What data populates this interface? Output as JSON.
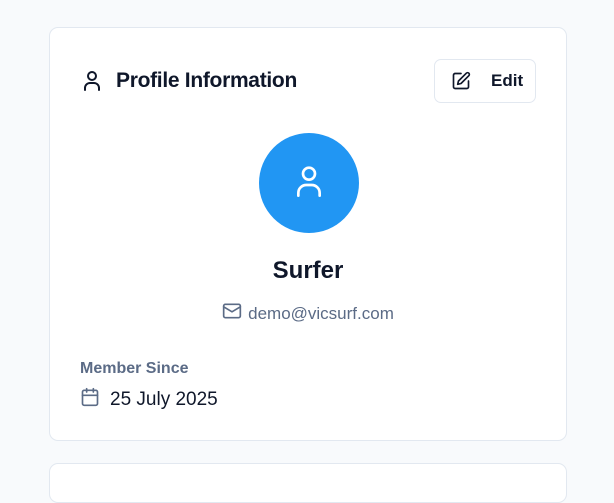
{
  "profile_card": {
    "title": "Profile Information",
    "edit_label": "Edit",
    "user_name": "Surfer",
    "email": "demo@vicsurf.com",
    "member_since_label": "Member Since",
    "member_since_date": "25 July 2025"
  },
  "icons": {
    "header": "user-icon",
    "edit": "edit-icon",
    "avatar": "user-icon",
    "email": "mail-icon",
    "date": "calendar-icon"
  },
  "colors": {
    "avatar_bg": "#2196f3",
    "muted_text": "#5b6b86",
    "primary_text": "#0f172a",
    "border": "#e2e8f0"
  }
}
